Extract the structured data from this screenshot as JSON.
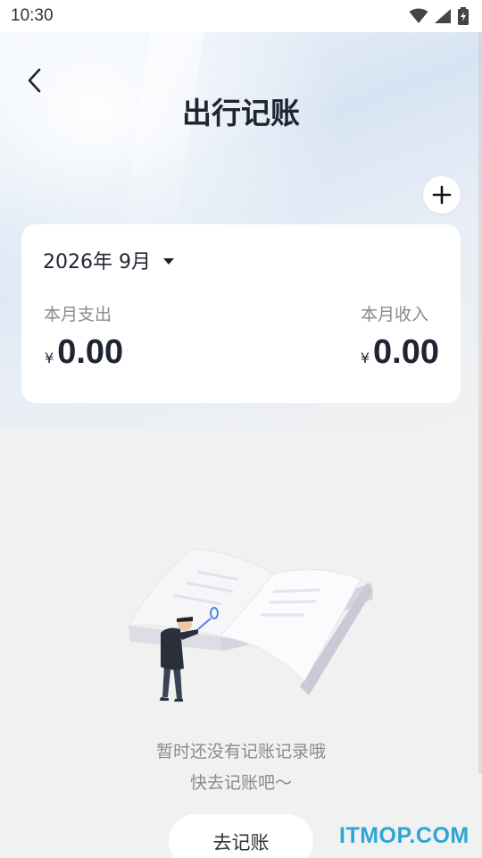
{
  "status_bar": {
    "time": "10:30",
    "icons": [
      "wifi-icon",
      "signal-icon",
      "battery-icon"
    ]
  },
  "header": {
    "title": "出行记账",
    "back_icon": "back-arrow-icon",
    "add_icon": "plus-icon"
  },
  "summary": {
    "month": "2026年 9月",
    "expense_label": "本月支出",
    "expense_currency": "¥",
    "expense_amount": "0.00",
    "income_label": "本月收入",
    "income_currency": "¥",
    "income_amount": "0.00"
  },
  "empty_state": {
    "line1": "暂时还没有记账记录哦",
    "line2": "快去记账吧～",
    "button_label": "去记账"
  },
  "watermark": "ITMOP.COM",
  "colors": {
    "accent_watermark": "#2ca6d6",
    "card": "#ffffff",
    "background": "#f1f1f1"
  }
}
